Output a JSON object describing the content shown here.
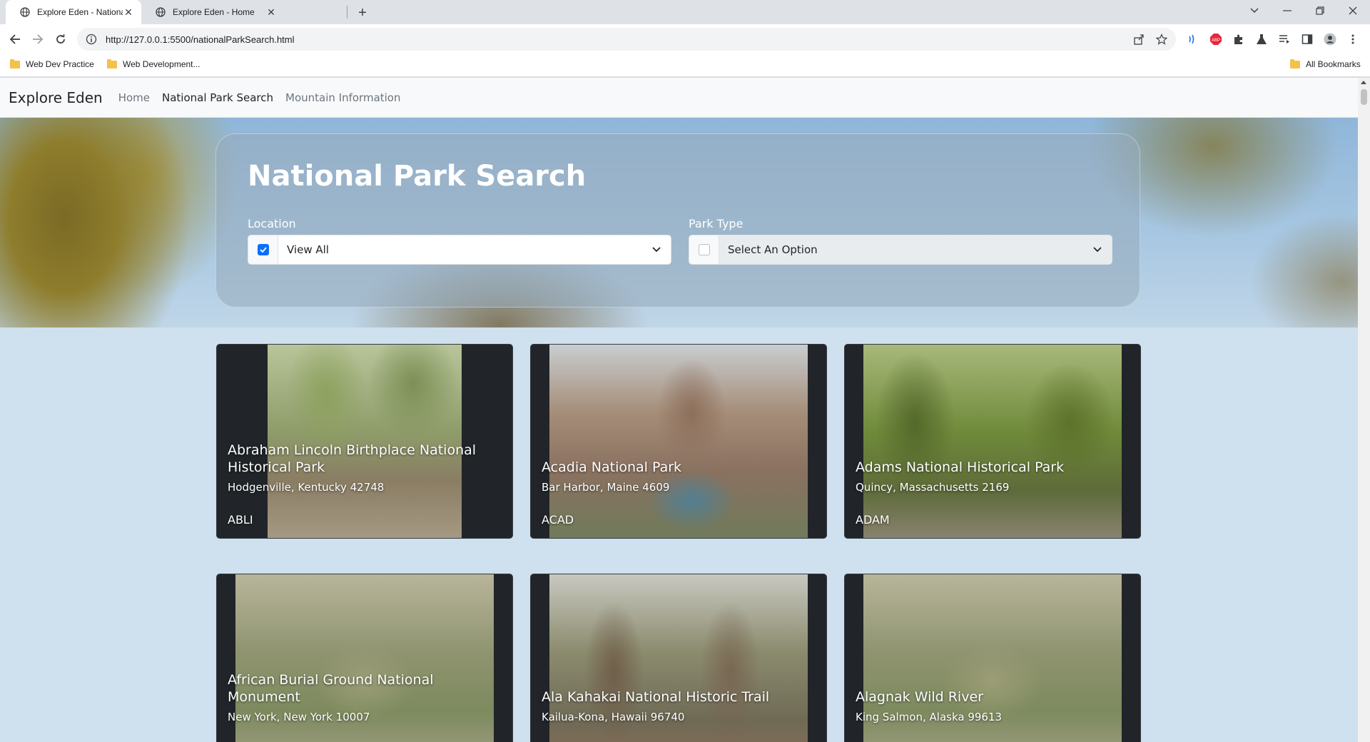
{
  "browser": {
    "tabs": [
      {
        "title": "Explore Eden - National Park Se",
        "active": true
      },
      {
        "title": "Explore Eden - Home",
        "active": false
      }
    ],
    "url": "http://127.0.0.1:5500/nationalParkSearch.html",
    "bookmarks": [
      {
        "label": "Web Dev Practice"
      },
      {
        "label": "Web Development..."
      }
    ],
    "all_bookmarks_label": "All Bookmarks"
  },
  "site": {
    "brand": "Explore Eden",
    "nav": [
      {
        "label": "Home",
        "active": false
      },
      {
        "label": "National Park Search",
        "active": true
      },
      {
        "label": "Mountain Information",
        "active": false
      }
    ]
  },
  "search": {
    "title": "National Park Search",
    "location": {
      "label": "Location",
      "value": "View All",
      "checked": true
    },
    "park_type": {
      "label": "Park Type",
      "value": "Select An Option",
      "checked": false
    }
  },
  "parks": [
    {
      "name": "Abraham Lincoln Birthplace National Historical Park",
      "location": "Hodgenville, Kentucky 42748",
      "code": "ABLI"
    },
    {
      "name": "Acadia National Park",
      "location": "Bar Harbor, Maine 4609",
      "code": "ACAD"
    },
    {
      "name": "Adams National Historical Park",
      "location": "Quincy, Massachusetts 2169",
      "code": "ADAM"
    },
    {
      "name": "African Burial Ground National Monument",
      "location": "New York, New York 10007",
      "code": ""
    },
    {
      "name": "Ala Kahakai National Historic Trail",
      "location": "Kailua-Kona, Hawaii 96740",
      "code": ""
    },
    {
      "name": "Alagnak Wild River",
      "location": "King Salmon, Alaska 99613",
      "code": ""
    }
  ],
  "colors": {
    "checkbox_accent": "#0d6efd",
    "card_background": "#212529",
    "page_background": "#cfe0ee"
  }
}
